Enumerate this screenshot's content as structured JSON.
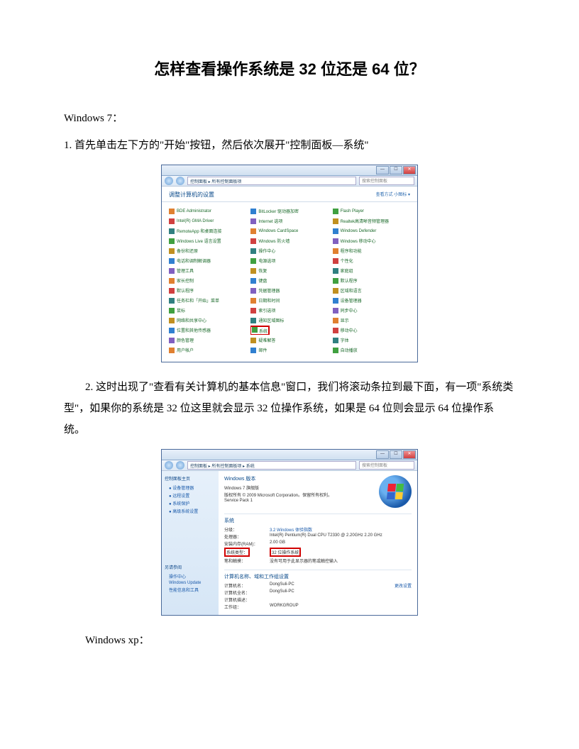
{
  "title": "怎样查看操作系统是 32 位还是 64 位？",
  "section_win7": "Windows 7：",
  "step1": "1. 首先单击左下方的\"开始\"按钮，然后依次展开\"控制面板—系统\"",
  "step2": "2. 这时出现了\"查看有关计算机的基本信息\"窗口，我们将滚动条拉到最下面，有一项\"系统类型\"，如果你的系统是 32 位这里就会显示 32 位操作系统，如果是 64 位则会显示 64 位操作系统。",
  "section_winxp": "Windows xp：",
  "cp": {
    "path": "控制面板 ▸ 所有控制面板项",
    "search_placeholder": "搜索控制面板",
    "header": "调整计算机的设置",
    "view_label": "查看方式  小图标 ▾",
    "items_col1": [
      "BDE Administrator",
      "Intel(R) GMA Driver",
      "RemoteApp 和桌面连接",
      "Windows Live 语言设置",
      "备份和还原",
      "电话和调制解调器",
      "管理工具",
      "家长控制",
      "默认程序",
      "任务栏和「开始」菜单",
      "鼠标",
      "网络和共享中心",
      "位置和其他传感器",
      "颜色管理",
      "用户帐户"
    ],
    "items_col2": [
      "BitLocker 驱动器加密",
      "Internet 选项",
      "Windows CardSpace",
      "Windows 防火墙",
      "操作中心",
      "电源选项",
      "恢复",
      "键盘",
      "凭据管理器",
      "日期和时间",
      "索引选项",
      "通知区域图标",
      "系统",
      "疑难解答",
      "邮件"
    ],
    "items_col3": [
      "Flash Player",
      "Realtek高清晰音频管理器",
      "Windows Defender",
      "Windows 移动中心",
      "程序和功能",
      "个性化",
      "家庭组",
      "默认程序",
      "区域和语言",
      "设备管理器",
      "同步中心",
      "显示",
      "移动中心",
      "字体",
      "自动播放"
    ],
    "highlighted": "系统"
  },
  "sys": {
    "path": "控制面板 ▸ 所有控制面板项 ▸ 系统",
    "search_placeholder": "搜索控制面板",
    "sidebar_title": "控制面板主页",
    "sidebar_links": [
      "设备管理器",
      "远程设置",
      "系统保护",
      "高级系统设置"
    ],
    "sidebar_bottom_title": "另请参阅",
    "sidebar_bottom": [
      "操作中心",
      "Windows Update",
      "性能信息和工具"
    ],
    "edition_title": "Windows 版本",
    "edition_line1": "Windows 7 旗舰版",
    "edition_line2": "版权所有 © 2009 Microsoft Corporation。保留所有权利。",
    "edition_line3": "Service Pack 1",
    "sys_section": "系统",
    "rating_label": "分级：",
    "rating_val": "3.2  Windows 体验指数",
    "cpu_label": "处理器：",
    "cpu_val": "Intel(R) Pentium(R) Dual CPU  T2330 @ 2.20GHz  2.20 GHz",
    "ram_label": "安装内存(RAM)：",
    "ram_val": "2.00 GB",
    "type_label": "系统类型：",
    "type_val": "32 位操作系统",
    "pen_label": "笔和触摸：",
    "pen_val": "没有可用于此显示器的笔或触控输入",
    "name_section": "计算机名称、域和工作组设置",
    "name_label": "计算机名：",
    "name_val": "DongSuli-PC",
    "full_label": "计算机全名：",
    "full_val": "DongSuli-PC",
    "desc_label": "计算机描述：",
    "desc_val": "",
    "wg_label": "工作组：",
    "wg_val": "WORKGROUP",
    "change_link": "更改设置"
  }
}
